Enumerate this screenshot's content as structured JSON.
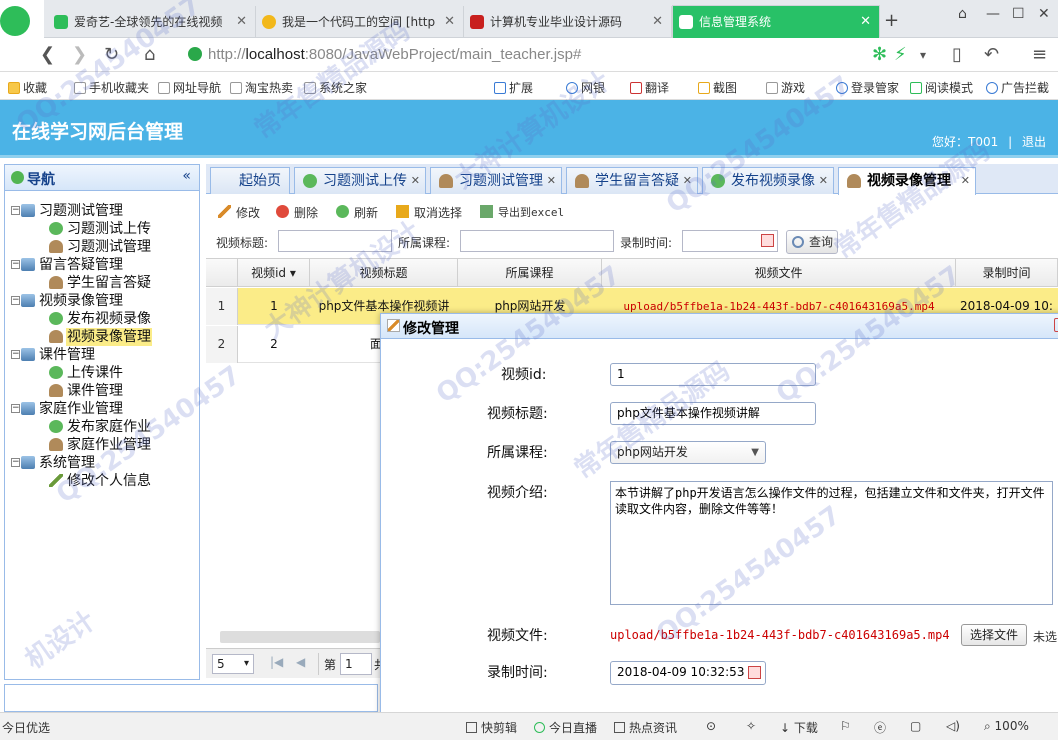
{
  "browser": {
    "tabs": [
      {
        "label": "爱奇艺-全球领先的在线视频",
        "color": "#2ebd59"
      },
      {
        "label": "我是一个代码工的空间 [http",
        "color": "#f2b81b"
      },
      {
        "label": "计算机专业毕业设计源码",
        "color": "#c8201e"
      },
      {
        "label": "信息管理系统",
        "color": "#2ebd59"
      }
    ],
    "add_tab": "+",
    "url_prefix": "http://",
    "url_host": "localhost",
    "url_rest": ":8080/JavaWebProject/main_teacher.jsp#",
    "bookmarks": [
      "收藏",
      "手机收藏夹",
      "网址导航",
      "淘宝热卖",
      "系统之家",
      "扩展",
      "网银",
      "翻译",
      "截图",
      "游戏",
      "登录管家",
      "阅读模式",
      "广告拦截"
    ]
  },
  "app": {
    "title": "在线学习网后台管理",
    "greeting": "您好：T001",
    "logout": "退出"
  },
  "nav": {
    "title": "导航",
    "collapse": "«",
    "items": [
      {
        "label": "习题测试管理",
        "level": 0,
        "icon": "pc-icon"
      },
      {
        "label": "习题测试上传",
        "level": 1,
        "icon": "add-icon"
      },
      {
        "label": "习题测试管理",
        "level": 1,
        "icon": "user-icon"
      },
      {
        "label": "留言答疑管理",
        "level": 0,
        "icon": "pc-icon"
      },
      {
        "label": "学生留言答疑",
        "level": 1,
        "icon": "user-icon"
      },
      {
        "label": "视频录像管理",
        "level": 0,
        "icon": "pc-icon"
      },
      {
        "label": "发布视频录像",
        "level": 1,
        "icon": "add-icon"
      },
      {
        "label": "视频录像管理",
        "level": 1,
        "icon": "user-icon",
        "selected": true
      },
      {
        "label": "课件管理",
        "level": 0,
        "icon": "pc-icon"
      },
      {
        "label": "上传课件",
        "level": 1,
        "icon": "add-icon"
      },
      {
        "label": "课件管理",
        "level": 1,
        "icon": "user-icon"
      },
      {
        "label": "家庭作业管理",
        "level": 0,
        "icon": "pc-icon"
      },
      {
        "label": "发布家庭作业",
        "level": 1,
        "icon": "add-icon"
      },
      {
        "label": "家庭作业管理",
        "level": 1,
        "icon": "user-icon"
      },
      {
        "label": "系统管理",
        "level": 0,
        "icon": "pc-icon"
      },
      {
        "label": "修改个人信息",
        "level": 1,
        "icon": "pencil-icon"
      }
    ]
  },
  "tabs": [
    {
      "label": "起始页",
      "closable": false
    },
    {
      "label": "习题测试上传",
      "closable": true
    },
    {
      "label": "习题测试管理",
      "closable": true
    },
    {
      "label": "学生留言答疑",
      "closable": true
    },
    {
      "label": "发布视频录像",
      "closable": true
    },
    {
      "label": "视频录像管理",
      "closable": true,
      "active": true
    }
  ],
  "toolbar": {
    "edit": "修改",
    "delete": "删除",
    "refresh": "刷新",
    "cancel_select": "取消选择",
    "export": "导出到excel"
  },
  "search": {
    "title_label": "视频标题:",
    "course_label": "所属课程:",
    "time_label": "录制时间:",
    "query": "查询"
  },
  "grid": {
    "columns": [
      "视频id",
      "视频标题",
      "所属课程",
      "视频文件",
      "录制时间"
    ],
    "rows": [
      {
        "rownum": "1",
        "id": "1",
        "title": "php文件基本操作视频讲",
        "course": "php网站开发",
        "file": "upload/b5ffbe1a-1b24-443f-bdb7-c401643169a5.mp4",
        "time": "2018-04-09 10:",
        "selected": true
      },
      {
        "rownum": "2",
        "id": "2",
        "title": "面向对象",
        "course": "",
        "file": "",
        "time": ""
      }
    ]
  },
  "pager": {
    "page_size": "5",
    "page_label": "第",
    "page_value": "1",
    "total_label": "共"
  },
  "dialog": {
    "title": "修改管理",
    "id_label": "视频id:",
    "id_value": "1",
    "title_label": "视频标题:",
    "title_value": "php文件基本操作视频讲解",
    "course_label": "所属课程:",
    "course_value": "php网站开发",
    "intro_label": "视频介绍:",
    "intro_value": "本节讲解了php开发语言怎么操作文件的过程，包括建立文件和文件夹，打开文件读取文件内容，删除文件等等！",
    "file_label": "视频文件:",
    "file_value": "upload/b5ffbe1a-1b24-443f-bdb7-c401643169a5.mp4",
    "choose_file": "选择文件",
    "no_file": "未选",
    "time_label": "录制时间:",
    "time_value": "2018-04-09 10:32:53"
  },
  "statusbar": {
    "left": "今日优选",
    "items": [
      "快剪辑",
      "今日直播",
      "热点资讯",
      "下载",
      "100%"
    ]
  },
  "watermarks": [
    "QQ:254540457",
    "常年售精品源码",
    "大神计算机设计",
    "QQ:254540457",
    "常年售精品源码",
    "QQ:254540457",
    "大神计算机设计",
    "QQ:254540457",
    "常年售精品源码",
    "QQ:254540457",
    "机设计",
    "QQ:254540457"
  ]
}
